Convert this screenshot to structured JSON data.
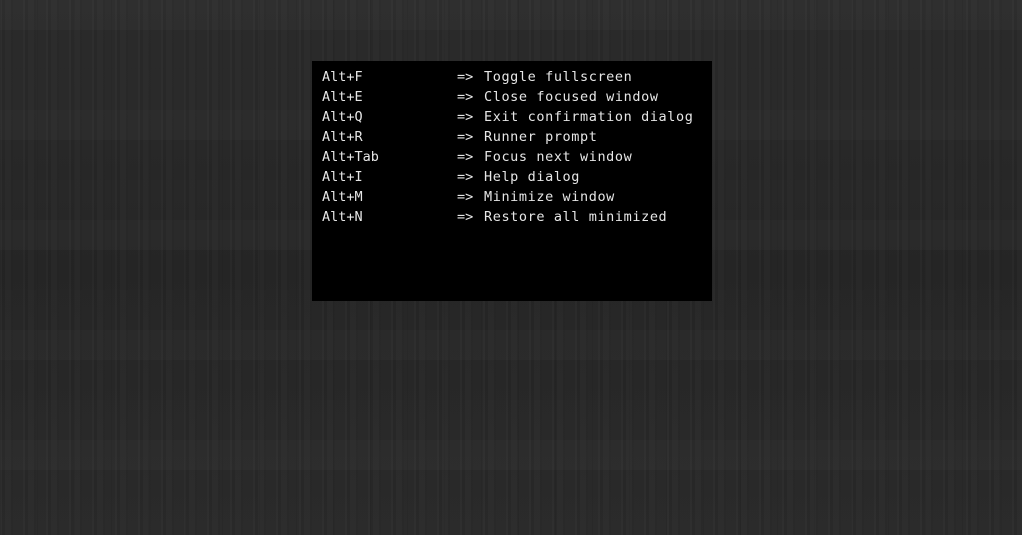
{
  "help_dialog": {
    "arrow": "=>",
    "shortcuts": [
      {
        "keys": "Alt+F",
        "action": "Toggle fullscreen"
      },
      {
        "keys": "Alt+E",
        "action": "Close focused window"
      },
      {
        "keys": "Alt+Q",
        "action": "Exit confirmation dialog"
      },
      {
        "keys": "Alt+R",
        "action": "Runner prompt"
      },
      {
        "keys": "Alt+Tab",
        "action": "Focus next window"
      },
      {
        "keys": "Alt+I",
        "action": "Help dialog"
      },
      {
        "keys": "Alt+M",
        "action": "Minimize window"
      },
      {
        "keys": "Alt+N",
        "action": "Restore all minimized"
      }
    ]
  }
}
